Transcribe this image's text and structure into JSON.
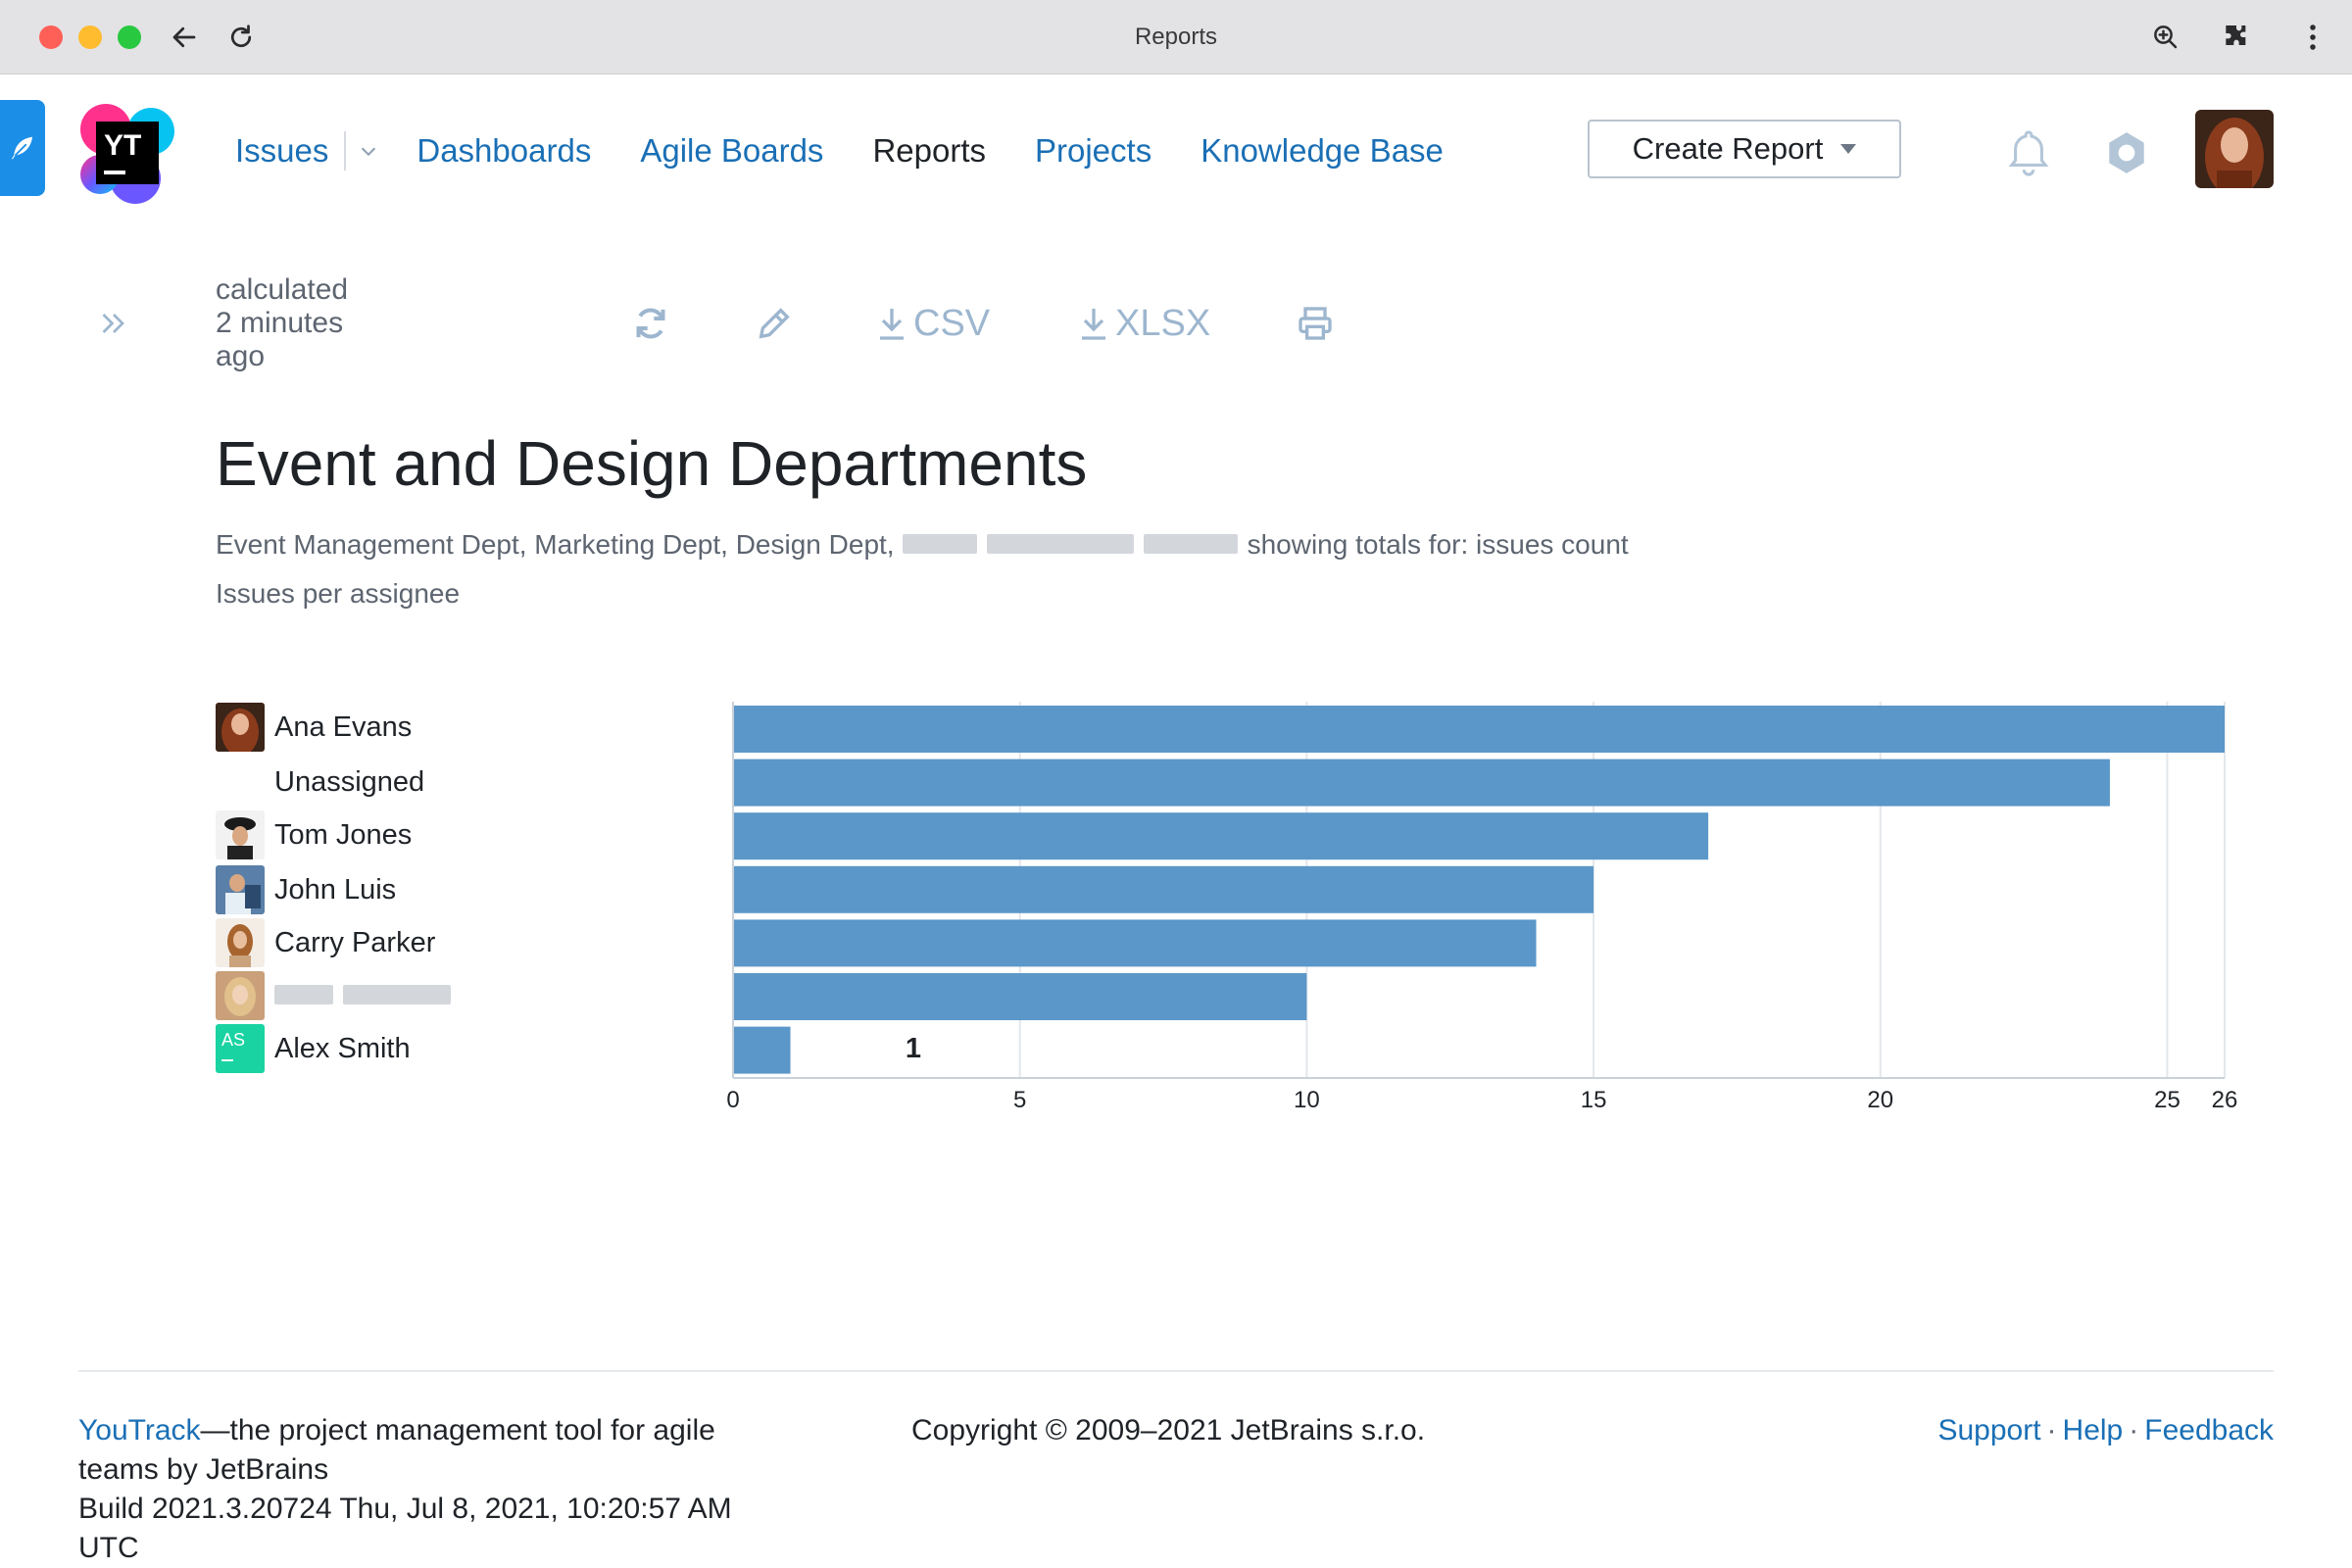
{
  "browser": {
    "title": "Reports",
    "back_icon": "arrow-left-icon",
    "reload_icon": "reload-icon",
    "zoom_icon": "zoom-in-icon",
    "extensions_icon": "puzzle-icon",
    "menu_icon": "kebab-menu-icon"
  },
  "header": {
    "logo_text": "YT",
    "nav": {
      "issues": "Issues",
      "dashboards": "Dashboards",
      "agile_boards": "Agile Boards",
      "reports": "Reports",
      "projects": "Projects",
      "knowledge_base": "Knowledge Base"
    },
    "create_report": "Create Report"
  },
  "toolbar": {
    "calculated": "calculated 2 minutes ago",
    "csv": "CSV",
    "xlsx": "XLSX"
  },
  "report": {
    "title": "Event and Design Departments",
    "subtitle_prefix": "Event Management Dept, Marketing Dept, Design Dept,",
    "subtitle_suffix": "showing totals for: issues count",
    "subtitle2": "Issues per assignee"
  },
  "chart_data": {
    "type": "bar",
    "orientation": "horizontal",
    "categories": [
      "Ana Evans",
      "Unassigned",
      "Tom Jones",
      "John Luis",
      "Carry Parker",
      "",
      "Alex Smith"
    ],
    "values": [
      26,
      24,
      17,
      15,
      14,
      10,
      1
    ],
    "xticks": [
      0,
      5,
      10,
      15,
      20,
      25,
      26
    ],
    "xlim": [
      0,
      26
    ],
    "grid": true,
    "bar_color": "#5b97c9"
  },
  "avatars": {
    "alex_smith_initials": "AS"
  },
  "footer": {
    "brand_link": "YouTrack",
    "brand_rest": "—the project management tool for agile teams by JetBrains",
    "build": "Build 2021.3.20724 Thu, Jul 8, 2021, 10:20:57 AM UTC",
    "copyright": "Copyright © 2009–2021 JetBrains s.r.o.",
    "links": [
      "Support",
      "Help",
      "Feedback"
    ]
  }
}
